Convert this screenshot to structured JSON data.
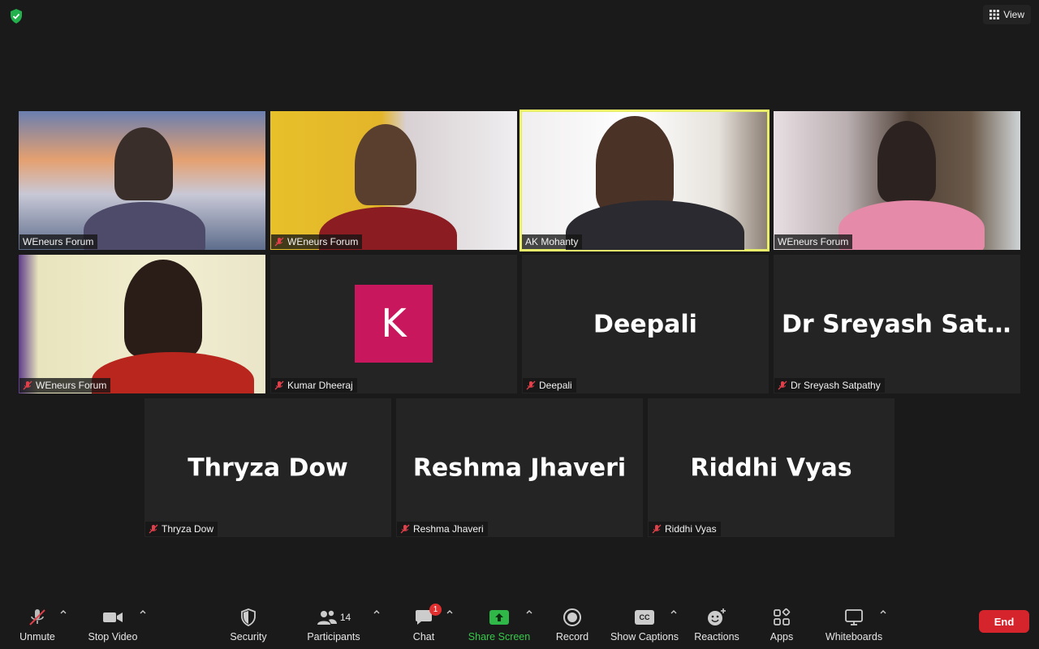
{
  "top": {
    "view_label": "View"
  },
  "tiles": [
    {
      "label": "WEneurs Forum",
      "muted": false
    },
    {
      "label": "WEneurs Forum",
      "muted": true
    },
    {
      "label": "AK Mohanty",
      "muted": false,
      "active": true
    },
    {
      "label": "WEneurs Forum",
      "muted": false
    },
    {
      "label": "WEneurs Forum",
      "muted": true
    },
    {
      "label": "Kumar Dheeraj",
      "muted": true,
      "avatar_letter": "K"
    },
    {
      "label": "Deepali",
      "muted": true,
      "big_name": "Deepali"
    },
    {
      "label": "Dr Sreyash Satpathy",
      "muted": true,
      "big_name": "Dr Sreyash Satpa..."
    },
    {
      "label": "Thryza Dow",
      "muted": true,
      "big_name": "Thryza Dow"
    },
    {
      "label": "Reshma Jhaveri",
      "muted": true,
      "big_name": "Reshma Jhaveri"
    },
    {
      "label": "Riddhi Vyas",
      "muted": true,
      "big_name": "Riddhi Vyas"
    }
  ],
  "toolbar": {
    "unmute": "Unmute",
    "stop_video": "Stop Video",
    "security": "Security",
    "participants": "Participants",
    "participants_count": "14",
    "chat": "Chat",
    "chat_badge": "1",
    "share_screen": "Share Screen",
    "record": "Record",
    "show_captions": "Show Captions",
    "captions_icon_text": "CC",
    "reactions": "Reactions",
    "apps": "Apps",
    "whiteboards": "Whiteboards",
    "end": "End"
  },
  "colors": {
    "active_speaker_border": "#e9f06a",
    "avatar_bg": "#c9175d",
    "share_green": "#36c94a",
    "end_red": "#d6242d",
    "muted_red": "#e0404a"
  }
}
